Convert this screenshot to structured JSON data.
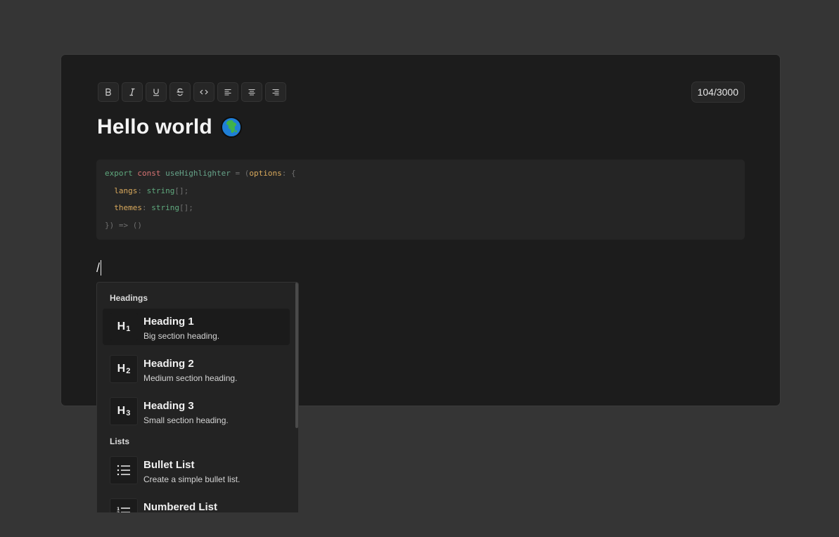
{
  "toolbar": {
    "buttons": [
      {
        "name": "bold-button",
        "icon": "bold-icon",
        "label": "B"
      },
      {
        "name": "italic-button",
        "icon": "italic-icon",
        "label": "I"
      },
      {
        "name": "underline-button",
        "icon": "underline-icon",
        "label": "U"
      },
      {
        "name": "strikethrough-button",
        "icon": "strikethrough-icon",
        "label": "S"
      },
      {
        "name": "code-button",
        "icon": "code-icon",
        "label": "<>"
      },
      {
        "name": "align-left-button",
        "icon": "align-left-icon"
      },
      {
        "name": "align-center-button",
        "icon": "align-center-icon"
      },
      {
        "name": "align-right-button",
        "icon": "align-right-icon"
      }
    ],
    "char_count": "104/3000"
  },
  "document": {
    "title": "Hello world",
    "title_emoji": "globe-africa-icon",
    "code": {
      "line1": {
        "kw": "export",
        "const": "const",
        "fn": "useHighlighter",
        "eq": " = (",
        "prop": "options",
        "rest": ": {"
      },
      "line2": {
        "prop": "langs",
        "colon": ": ",
        "type": "string",
        "rest": "[];"
      },
      "line3": {
        "prop": "themes",
        "colon": ": ",
        "type": "string",
        "rest": "[];"
      },
      "line4": {
        "text": "}) => ()"
      }
    },
    "slash_text": "/"
  },
  "slash_menu": {
    "groups": [
      {
        "label": "Headings"
      },
      {
        "label": "Lists"
      }
    ],
    "items": [
      {
        "icon_main": "H",
        "icon_sub": "1",
        "title": "Heading 1",
        "desc": "Big section heading."
      },
      {
        "icon_main": "H",
        "icon_sub": "2",
        "title": "Heading 2",
        "desc": "Medium section heading."
      },
      {
        "icon_main": "H",
        "icon_sub": "3",
        "title": "Heading 3",
        "desc": "Small section heading."
      },
      {
        "icon": "bullet-list-icon",
        "title": "Bullet List",
        "desc": "Create a simple bullet list."
      },
      {
        "icon": "numbered-list-icon",
        "title": "Numbered List",
        "desc": ""
      }
    ]
  },
  "colors": {
    "page_bg": "#353535",
    "card_bg": "#1c1c1c",
    "code_bg": "#252525",
    "keyword": "#5fa97e",
    "const": "#d97474",
    "property": "#d9a95c"
  }
}
